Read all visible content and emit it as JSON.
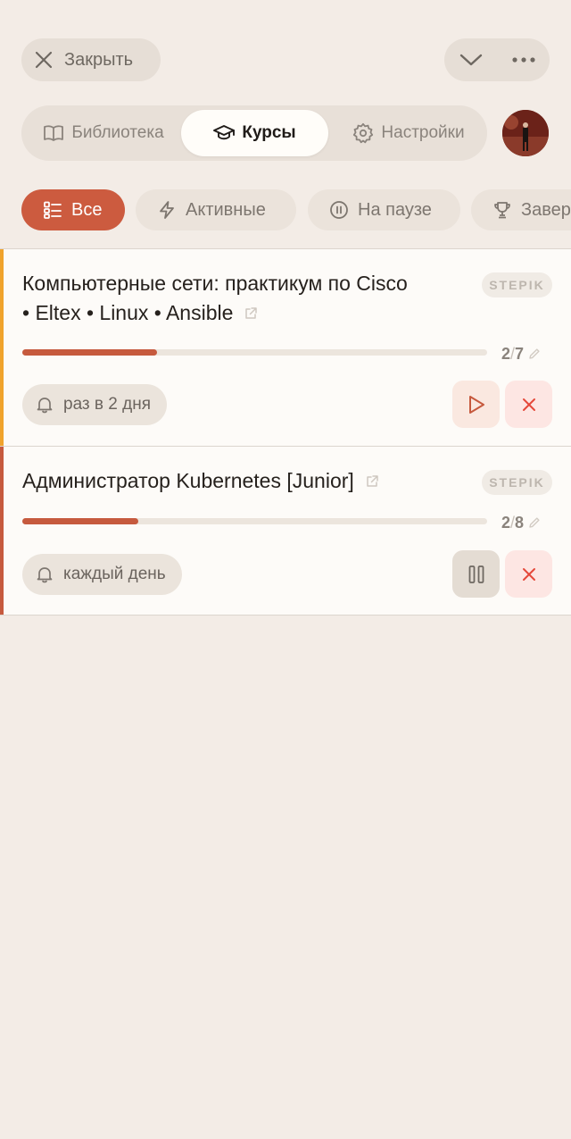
{
  "header": {
    "close_label": "Закрыть",
    "close_icon": "close-icon",
    "collapse_icon": "chevron-down-icon",
    "more_icon": "more-horizontal-icon"
  },
  "nav": {
    "tabs": [
      {
        "label": "Библиотека",
        "icon": "book-icon",
        "active": false
      },
      {
        "label": "Курсы",
        "icon": "graduation-cap-icon",
        "active": true
      },
      {
        "label": "Настройки",
        "icon": "gear-icon",
        "active": false
      }
    ]
  },
  "filters": [
    {
      "label": "Все",
      "icon": "list-icon",
      "active": true
    },
    {
      "label": "Активные",
      "icon": "lightning-icon",
      "active": false
    },
    {
      "label": "На паузе",
      "icon": "pause-circle-icon",
      "active": false
    },
    {
      "label": "Завер",
      "icon": "trophy-icon",
      "active": false
    }
  ],
  "courses": [
    {
      "title_line1": "Компьютерные сети: практикум по Cisco",
      "title_line2": "• Eltex • Linux • Ansible",
      "platform": "STEPIK",
      "done": "2",
      "separator": "/",
      "total": "7",
      "progress": 0.29,
      "reminder": "раз в 2 дня",
      "status_color": "#f0a32c",
      "action": "play"
    },
    {
      "title_line1": "Администратор Kubernetes [Junior]",
      "platform": "STEPIK",
      "done": "2",
      "separator": "/",
      "total": "8",
      "progress": 0.25,
      "reminder": "каждый день",
      "status_color": "#c65a3e",
      "action": "pause"
    }
  ],
  "colors": {
    "accent": "#cc5b3f",
    "background": "#f3ece6",
    "card": "#fdfbf8",
    "delete": "#e5483a"
  }
}
